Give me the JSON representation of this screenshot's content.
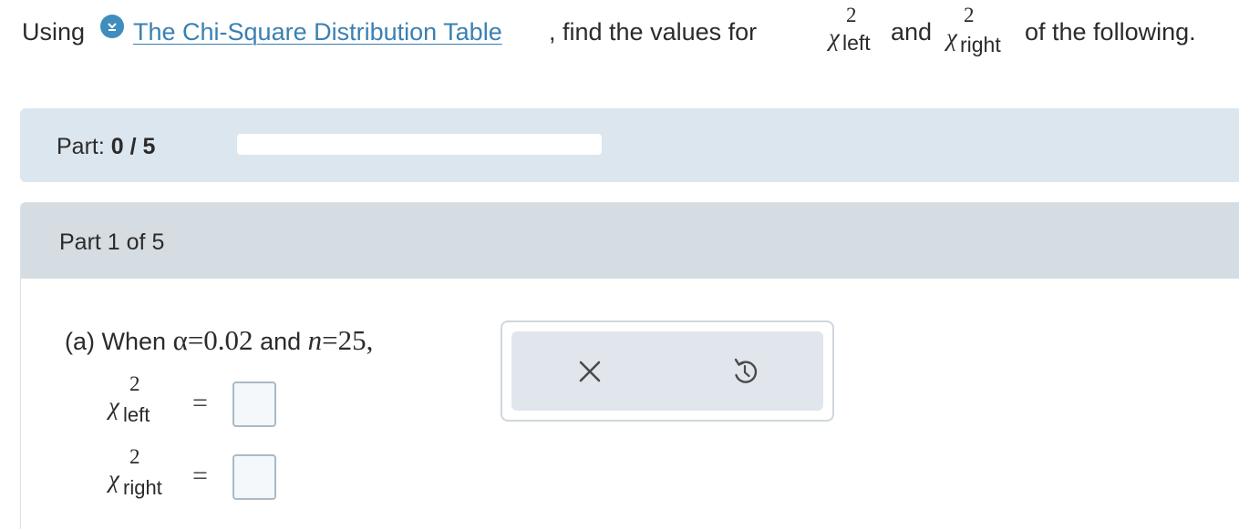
{
  "prompt": {
    "lead": "Using",
    "table_link": "The Chi-Square Distribution Table",
    "middle": ", find the values for",
    "chi_symbol": "χ",
    "superscript": "2",
    "left_sub": "left",
    "and": "and",
    "right_sub": "right",
    "tail": "of the following.",
    "download_icon": "download-icon"
  },
  "progress": {
    "label": "Part:",
    "value": "0 / 5",
    "fraction": 0,
    "fill_color": "#3f8dbd"
  },
  "part": {
    "title": "Part 1 of 5"
  },
  "question": {
    "prefix": "(a) When",
    "alpha": "α",
    "eq1": "=",
    "alpha_value": "0.02",
    "and": "and",
    "n_var": "n",
    "eq2": "=",
    "n_value": "25,"
  },
  "answers": [
    {
      "symbol": "χ",
      "sup": "2",
      "sub": "left",
      "equals": "=",
      "value": ""
    },
    {
      "symbol": "χ",
      "sup": "2",
      "sub": "right",
      "equals": "=",
      "value": ""
    }
  ],
  "toolbar": {
    "clear_icon": "close-icon",
    "undo_icon": "undo-icon"
  },
  "colors": {
    "accent": "#3f8dbd",
    "link": "#3a80b3",
    "panel_bg": "#dce6ef",
    "part_header_bg": "#d6dde2"
  }
}
